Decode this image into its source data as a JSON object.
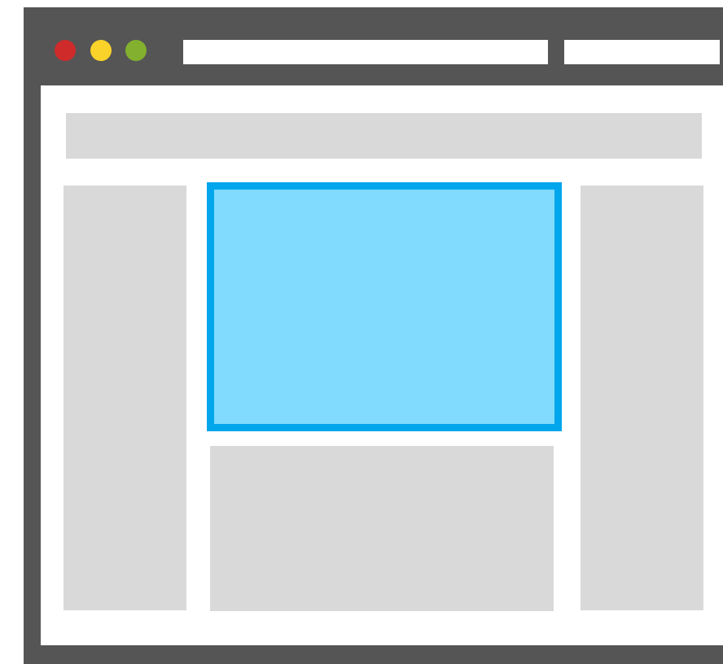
{
  "colors": {
    "window_frame": "#555555",
    "close_dot": "#cf2b2b",
    "minimize_dot": "#f9d22a",
    "maximize_dot": "#83b02e",
    "placeholder": "#d9d9d9",
    "highlight_fill": "#80dbff",
    "highlight_border": "#00a6ec"
  },
  "window": {
    "controls": [
      "close",
      "minimize",
      "maximize"
    ],
    "address_bar": "",
    "search_bar": ""
  },
  "layout": {
    "highlighted_region": "main-content-top"
  }
}
